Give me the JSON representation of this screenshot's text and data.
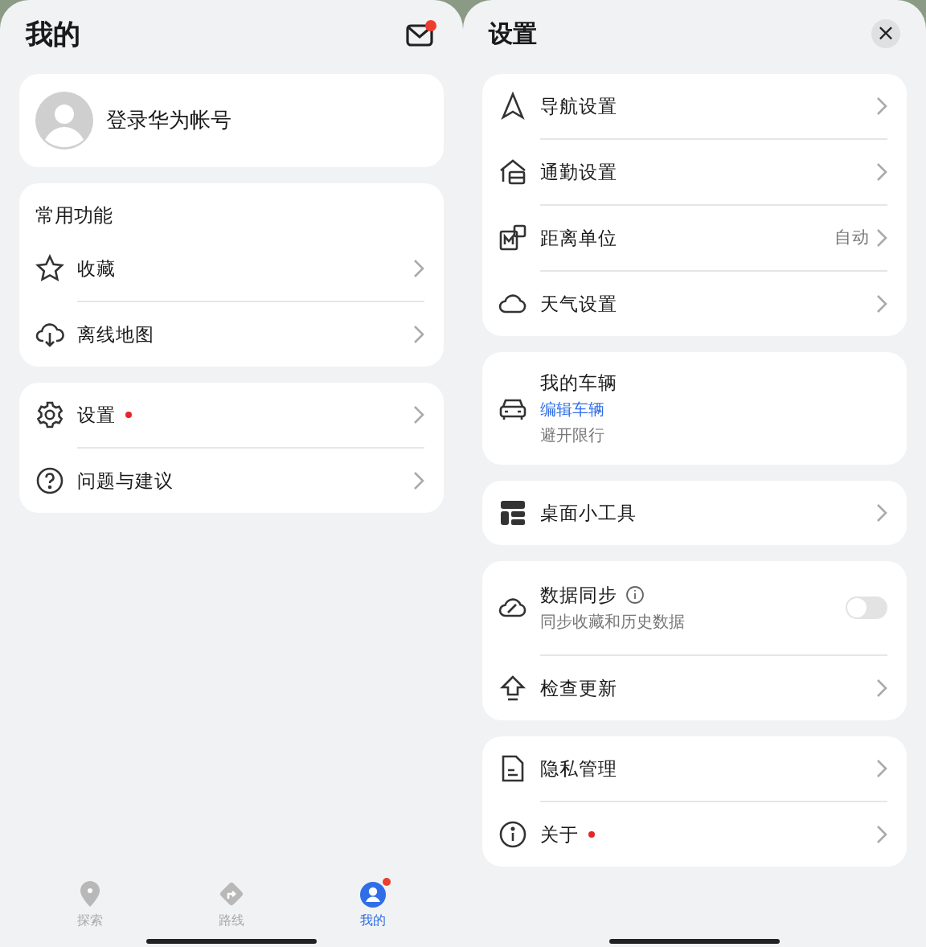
{
  "mine": {
    "title": "我的",
    "mail_unread": true,
    "account": {
      "label": "登录华为帐号"
    },
    "sections": [
      {
        "heading": "常用功能",
        "items": [
          {
            "label": "收藏",
            "dot": false
          },
          {
            "label": "离线地图",
            "dot": false
          }
        ]
      },
      {
        "items": [
          {
            "label": "设置",
            "dot": true
          },
          {
            "label": "问题与建议",
            "dot": false
          }
        ]
      }
    ],
    "nav": [
      {
        "label": "探索",
        "selected": false,
        "badge": false
      },
      {
        "label": "路线",
        "selected": false,
        "badge": false
      },
      {
        "label": "我的",
        "selected": true,
        "badge": true
      }
    ]
  },
  "settings": {
    "title": "设置",
    "close": "×",
    "groups": [
      {
        "items": [
          {
            "kind": "link",
            "label": "导航设置",
            "dot": false
          },
          {
            "kind": "link",
            "label": "通勤设置",
            "dot": false
          },
          {
            "kind": "link",
            "label": "距离单位",
            "value": "自动",
            "dot": false
          },
          {
            "kind": "link",
            "label": "天气设置",
            "dot": false
          }
        ]
      },
      {
        "items": [
          {
            "kind": "vehicle",
            "label": "我的车辆",
            "link": "编辑车辆",
            "sub": "避开限行"
          }
        ]
      },
      {
        "items": [
          {
            "kind": "link",
            "label": "桌面小工具",
            "dot": false
          }
        ]
      },
      {
        "items": [
          {
            "kind": "toggle",
            "label": "数据同步",
            "sub": "同步收藏和历史数据",
            "on": false
          },
          {
            "kind": "link",
            "label": "检查更新",
            "dot": false
          }
        ]
      },
      {
        "items": [
          {
            "kind": "link",
            "label": "隐私管理",
            "dot": false
          },
          {
            "kind": "link",
            "label": "关于",
            "dot": true
          }
        ]
      }
    ]
  }
}
